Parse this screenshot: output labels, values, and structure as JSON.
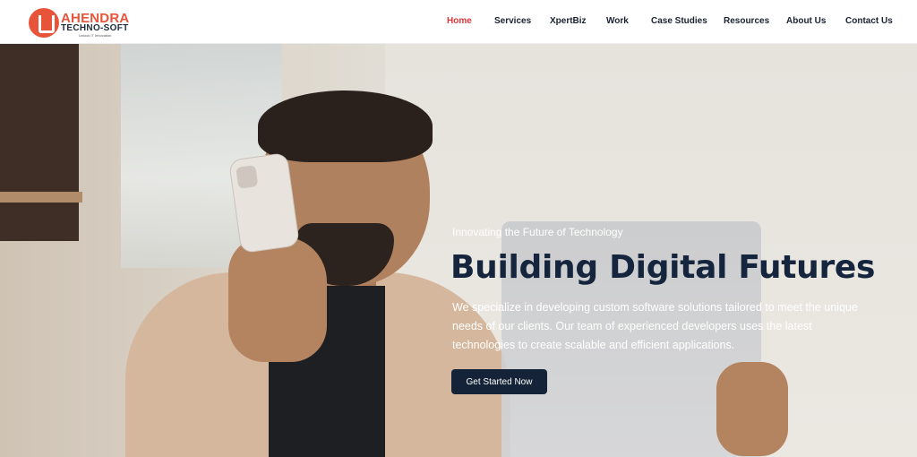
{
  "header": {
    "logo": {
      "top": "AHENDRA",
      "bottom": "TECHNO-SOFT",
      "tag": "Unlock IT Innovation"
    },
    "nav": [
      {
        "label": "Home",
        "active": true
      },
      {
        "label": "Services"
      },
      {
        "label": "XpertBiz"
      },
      {
        "label": "Work"
      },
      {
        "label": "Case Studies"
      },
      {
        "label": "Resources"
      },
      {
        "label": "About Us"
      },
      {
        "label": "Contact Us"
      }
    ]
  },
  "hero": {
    "eyebrow": "Innovating the Future of Technology",
    "headline": "Building Digital Futures",
    "description": "We specialize in developing custom software solutions tailored to meet the unique needs of our clients. Our team of experienced developers uses the latest technologies to create scalable and efficient applications.",
    "cta_label": "Get Started Now"
  },
  "colors": {
    "accent": "#d9383a",
    "brand_orange": "#e8543a",
    "headline_navy": "#14253d",
    "button_navy": "#142337"
  }
}
